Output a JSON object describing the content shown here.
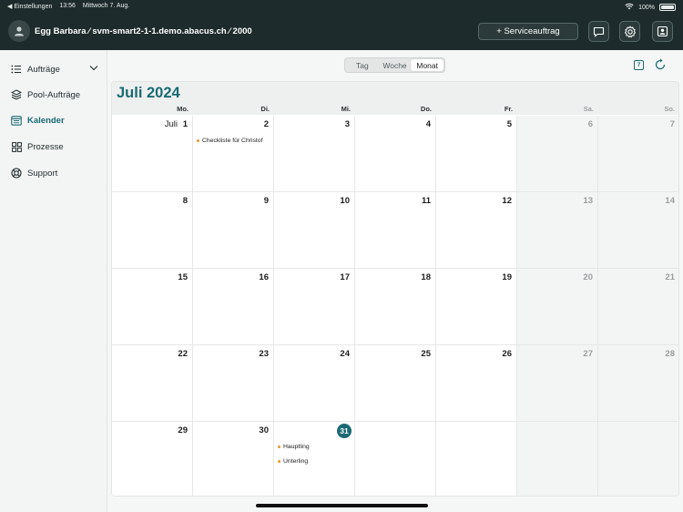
{
  "status_bar": {
    "back_app": "◀ Einstellungen",
    "time": "13:56",
    "date": "Mittwoch 7. Aug.",
    "battery": "100%"
  },
  "header": {
    "title": "Egg Barbara ⁄ svm-smart2-1-1.demo.abacus.ch ⁄ 2000",
    "service_button": "+ Serviceauftrag"
  },
  "sidebar": {
    "items": [
      {
        "label": "Aufträge",
        "icon": "list-icon"
      },
      {
        "label": "Pool-Aufträge",
        "icon": "layers-icon"
      },
      {
        "label": "Kalender",
        "icon": "calendar-icon",
        "active": true
      },
      {
        "label": "Prozesse",
        "icon": "grid-icon"
      },
      {
        "label": "Support",
        "icon": "lifebuoy-icon"
      }
    ]
  },
  "view_switch": {
    "options": [
      "Tag",
      "Woche",
      "Monat"
    ],
    "selected": "Monat"
  },
  "today_button": "7",
  "calendar": {
    "title": "Juli 2024",
    "weekdays": [
      "Mo.",
      "Di.",
      "Mi.",
      "Do.",
      "Fr.",
      "Sa.",
      "So."
    ],
    "month_label": "Juli",
    "weeks": [
      [
        "1",
        "2",
        "3",
        "4",
        "5",
        "6",
        "7"
      ],
      [
        "8",
        "9",
        "10",
        "11",
        "12",
        "13",
        "14"
      ],
      [
        "15",
        "16",
        "17",
        "18",
        "19",
        "20",
        "21"
      ],
      [
        "22",
        "23",
        "24",
        "25",
        "26",
        "27",
        "28"
      ],
      [
        "29",
        "30",
        "31",
        "",
        "",
        "",
        ""
      ]
    ],
    "today": "31",
    "events": [
      {
        "day": "2",
        "label": "Checkliste für Christof"
      },
      {
        "day": "31",
        "label": "Hauptling"
      },
      {
        "day": "31",
        "label": "Unterling"
      }
    ]
  },
  "colors": {
    "accent": "#1a6a73",
    "header_bg": "#1e2b2c",
    "event_dot": "#e39a2b"
  }
}
